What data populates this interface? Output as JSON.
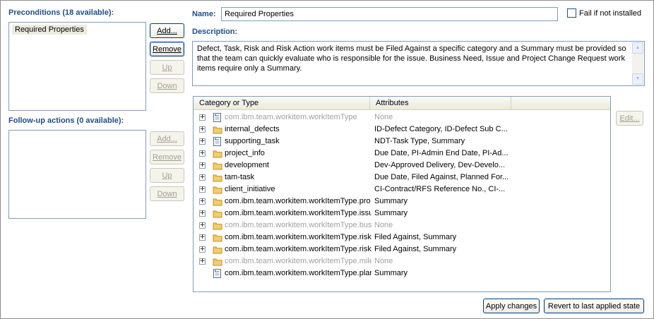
{
  "preconditions": {
    "label": "Preconditions (18 available):",
    "items": [
      "Required Properties"
    ],
    "buttons": {
      "add": "Add...",
      "remove": "Remove",
      "up": "Up",
      "down": "Down"
    }
  },
  "followup": {
    "label": "Follow-up actions (0 available):",
    "buttons": {
      "add": "Add...",
      "remove": "Remove",
      "up": "Up",
      "down": "Down"
    }
  },
  "details": {
    "name_label": "Name:",
    "name_value": "Required Properties",
    "fail_label": "Fail if not installed",
    "description_label": "Description:",
    "description_text": "Defect, Task, Risk and Risk Action work items must be Filed Against a specific category and a Summary must be provided so that the team can quickly evaluate who is responsible for the issue. Business Need, Issue and Project Change Request work items require only a Summary."
  },
  "table": {
    "columns": [
      "Category or Type",
      "Attributes"
    ],
    "edit_label": "Edit...",
    "rows": [
      {
        "name": "com.ibm.team.workitem.workItemType",
        "attrs": "None",
        "icon": "workitem-type-icon",
        "expandable": true,
        "disabled": true
      },
      {
        "name": "internal_defects",
        "attrs": "ID-Defect Category, ID-Defect Sub C...",
        "icon": "folder-icon",
        "expandable": true,
        "disabled": false
      },
      {
        "name": "supporting_task",
        "attrs": "NDT-Task Type, Summary",
        "icon": "workitem-type-icon",
        "expandable": true,
        "disabled": false
      },
      {
        "name": "project_info",
        "attrs": "Due Date, PI-Admin End Date, PI-Ad...",
        "icon": "folder-icon",
        "expandable": true,
        "disabled": false
      },
      {
        "name": "development",
        "attrs": "Dev-Approved Delivery, Dev-Develo...",
        "icon": "folder-icon",
        "expandable": true,
        "disabled": false
      },
      {
        "name": "tam-task",
        "attrs": "Due Date, Filed Against, Planned For...",
        "icon": "folder-icon",
        "expandable": true,
        "disabled": false
      },
      {
        "name": "client_initiative",
        "attrs": "CI-Contract/RFS Reference No., CI-...",
        "icon": "folder-icon",
        "expandable": true,
        "disabled": false
      },
      {
        "name": "com.ibm.team.workitem.workItemType.pro",
        "attrs": "Summary",
        "icon": "folder-icon",
        "expandable": true,
        "disabled": false
      },
      {
        "name": "com.ibm.team.workitem.workItemType.issu",
        "attrs": "Summary",
        "icon": "folder-icon",
        "expandable": true,
        "disabled": false
      },
      {
        "name": "com.ibm.team.workitem.workItemType.bus",
        "attrs": "None",
        "icon": "folder-icon",
        "expandable": true,
        "disabled": true
      },
      {
        "name": "com.ibm.team.workitem.workItemType.risk",
        "attrs": "Filed Against, Summary",
        "icon": "folder-icon",
        "expandable": true,
        "disabled": false
      },
      {
        "name": "com.ibm.team.workitem.workItemType.risk",
        "attrs": "Filed Against, Summary",
        "icon": "folder-icon",
        "expandable": true,
        "disabled": false
      },
      {
        "name": "com.ibm.team.workitem.workItemType.mile",
        "attrs": "None",
        "icon": "folder-icon",
        "expandable": true,
        "disabled": true
      },
      {
        "name": "com.ibm.team.workitem.workItemType.plar",
        "attrs": "Summary",
        "icon": "workitem-type-icon",
        "expandable": false,
        "disabled": false
      }
    ]
  },
  "footer": {
    "apply": "Apply changes",
    "revert": "Revert to last applied state"
  },
  "colors": {
    "section_label": "#1f4c8c",
    "border": "#7f9db9",
    "disabled_text": "#a0a0a0"
  }
}
